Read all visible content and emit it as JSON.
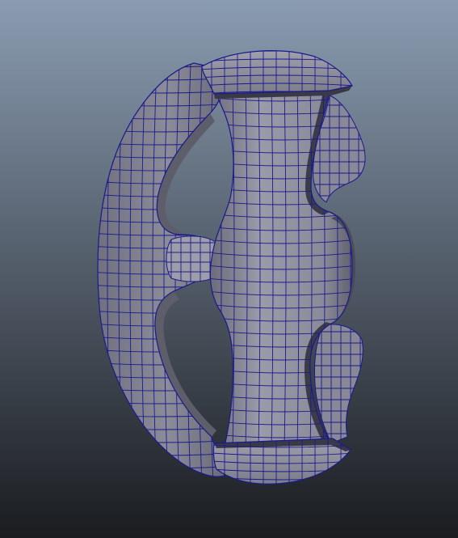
{
  "viewport": {
    "background_top": "#8a9cb1",
    "background_bottom": "#1a1c20",
    "mesh_fill": "#888896",
    "mesh_fill_light": "#9d9daa",
    "mesh_fill_dark": "#5e5e6a",
    "wire_color": "#1a1a8c"
  }
}
